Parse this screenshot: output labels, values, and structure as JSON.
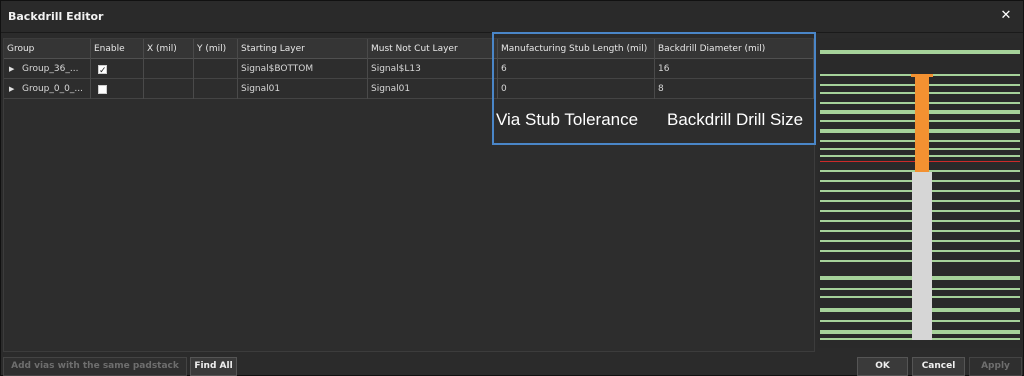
{
  "window": {
    "title": "Backdrill Editor",
    "close_glyph": "✕"
  },
  "grid": {
    "columns": [
      "Group",
      "Enable",
      "X (mil)",
      "Y (mil)",
      "Starting Layer",
      "Must Not Cut Layer",
      "Manufacturing Stub Length (mil)",
      "Backdrill Diameter (mil)"
    ],
    "rows": [
      {
        "expander": "▶",
        "group": "Group_36_...",
        "enabled": true,
        "x": "",
        "y": "",
        "starting_layer": "Signal$BOTTOM",
        "must_not_cut_layer": "Signal$L13",
        "stub_length": "6",
        "diameter": "16"
      },
      {
        "expander": "▶",
        "group": "Group_0_0_...",
        "enabled": false,
        "x": "",
        "y": "",
        "starting_layer": "Signal01",
        "must_not_cut_layer": "Signal01",
        "stub_length": "0",
        "diameter": "8"
      }
    ]
  },
  "annotations": {
    "label_1": "Via Stub Tolerance",
    "label_2": "Backdrill Drill Size",
    "box_color": "#4a86c8"
  },
  "buttons": {
    "add_vias": "Add vias with the same padstack",
    "find_all": "Find All",
    "ok": "OK",
    "cancel": "Cancel",
    "apply": "Apply"
  },
  "preview_colors": {
    "layer": "#a6d29a",
    "backdrill": "#f39131",
    "barrel": "#d6d6d6",
    "limit_line": "#cc2a2a"
  }
}
